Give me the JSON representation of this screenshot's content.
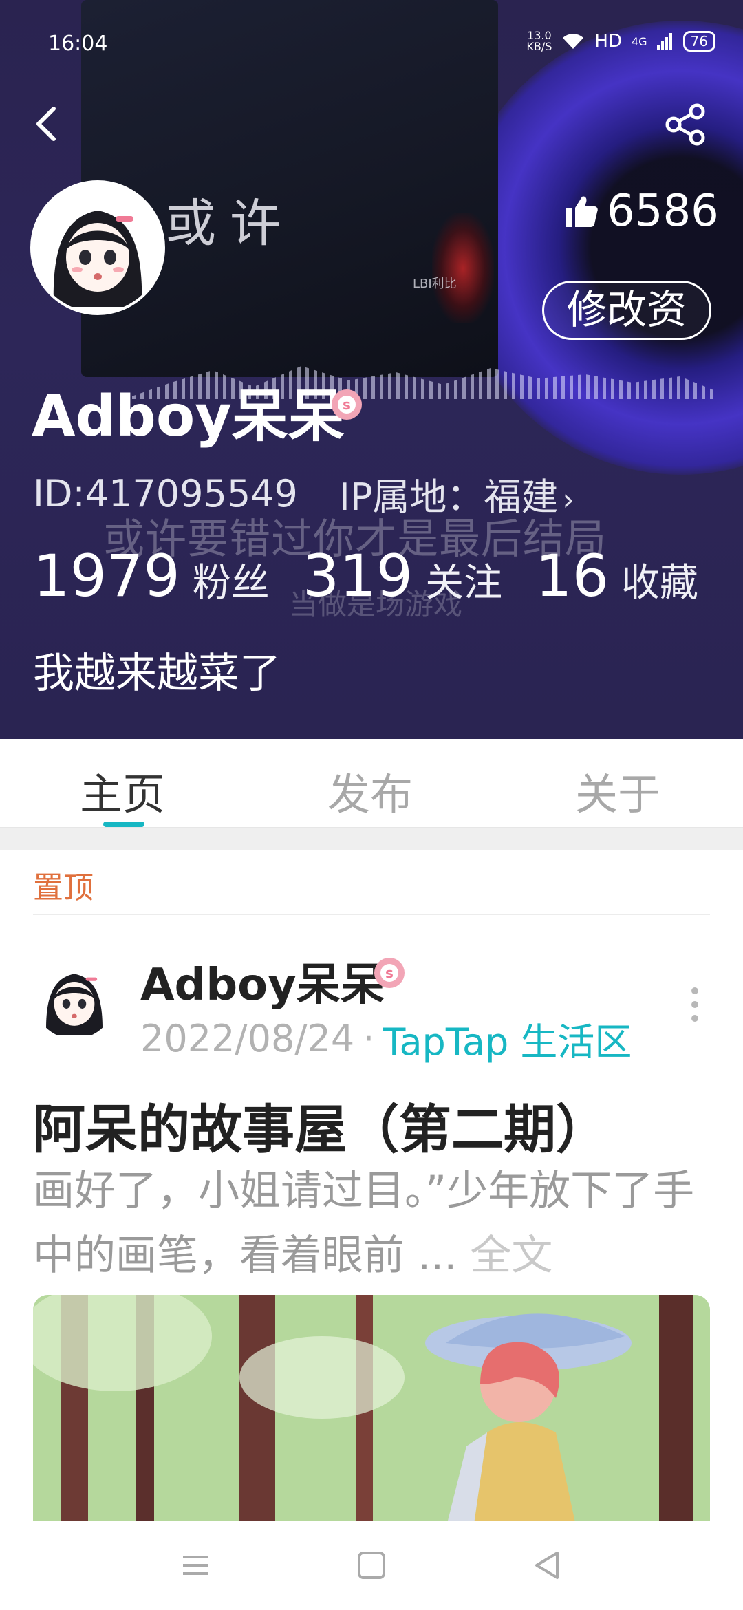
{
  "status_bar": {
    "time": "16:04",
    "net_speed_value": "13.0",
    "net_speed_unit": "KB/S",
    "hd": "HD",
    "signal": "4G",
    "battery": "76"
  },
  "header": {
    "album_title": "或许",
    "album_artist": "LBI利比",
    "lyric_line_1": "或许要错过你才是最后结局",
    "lyric_line_2": "当做是场游戏",
    "likes_count": "6586",
    "edit_button_label": "修改资",
    "username": "Adboy呆呆",
    "user_id": "ID:417095549",
    "ip_location": "IP属地：福建",
    "stats": [
      {
        "value": "1979",
        "label": "粉丝"
      },
      {
        "value": "319",
        "label": "关注"
      },
      {
        "value": "16",
        "label": "收藏"
      }
    ],
    "bio": "我越来越菜了"
  },
  "tabs": [
    {
      "label": "主页",
      "active": true
    },
    {
      "label": "发布",
      "active": false
    },
    {
      "label": "关于",
      "active": false
    }
  ],
  "feed": {
    "pinned_label": "置顶",
    "post": {
      "author": "Adboy呆呆",
      "date": "2022/08/24",
      "separator": "·",
      "board": "TapTap 生活区",
      "title": "阿呆的故事屋（第二期）",
      "excerpt": "画好了，小姐请过目。”少年放下了手中的画笔，看着眼前 ...",
      "fulltext_label": "全文"
    }
  },
  "colors": {
    "accent_teal": "#17b7c3",
    "pinned_orange": "#e0703d",
    "header_bg": "#2a2350"
  }
}
